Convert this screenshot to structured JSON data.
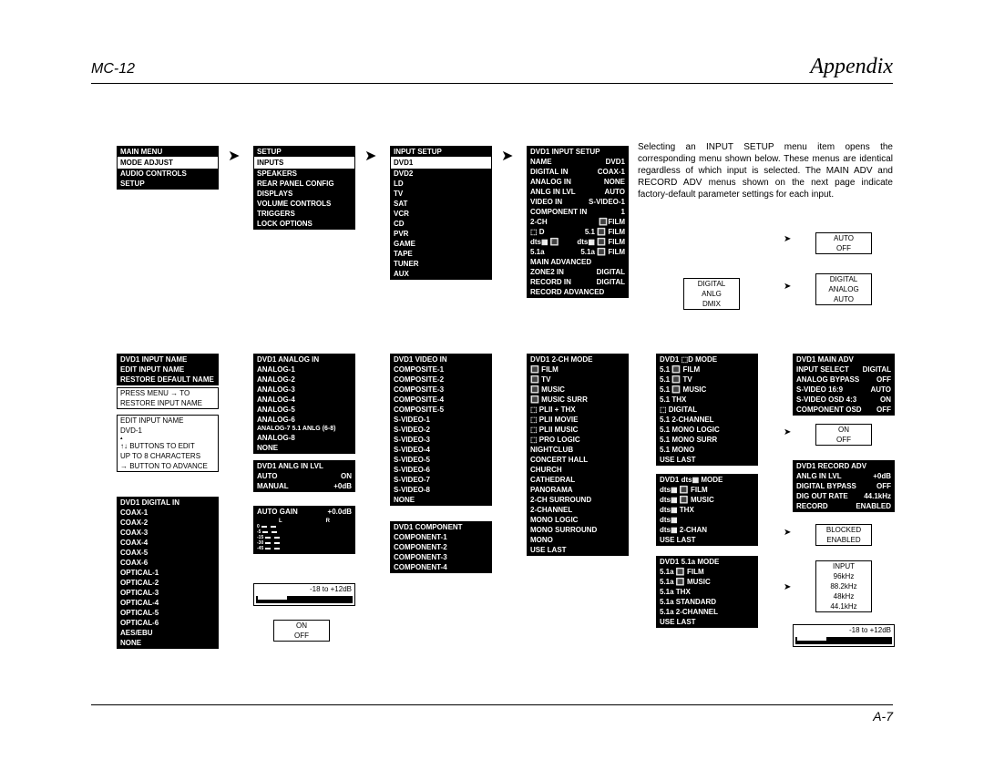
{
  "header": {
    "left": "MC-12",
    "right": "Appendix"
  },
  "footer": "A-7",
  "bodyText": "Selecting an INPUT SETUP menu item opens the corresponding menu shown below. These menus are identical regardless of which input is selected. The MAIN ADV and RECORD ADV menus shown on the next page indicate factory-default parameter settings for each input.",
  "mainMenu": {
    "title": "MAIN MENU",
    "sel": "MODE ADJUST",
    "items": [
      "AUDIO CONTROLS",
      "SETUP"
    ]
  },
  "setup": {
    "title": "SETUP",
    "sel": "INPUTS",
    "items": [
      "SPEAKERS",
      "REAR PANEL CONFIG",
      "DISPLAYS",
      "VOLUME CONTROLS",
      "TRIGGERS",
      "LOCK OPTIONS"
    ]
  },
  "inputSetup": {
    "title": "INPUT SETUP",
    "sel": "DVD1",
    "items": [
      "DVD2",
      "LD",
      "TV",
      "SAT",
      "VCR",
      "CD",
      "PVR",
      "GAME",
      "TAPE",
      "TUNER",
      "AUX"
    ]
  },
  "dvd1InputSetup": {
    "title": "DVD1 INPUT SETUP",
    "rows": [
      [
        "NAME",
        "DVD1"
      ],
      [
        "DIGITAL IN",
        "COAX-1"
      ],
      [
        "ANALOG IN",
        "NONE"
      ],
      [
        "ANLG IN LVL",
        "AUTO"
      ],
      [
        "VIDEO IN",
        "S-VIDEO-1"
      ],
      [
        "COMPONENT IN",
        "1"
      ],
      [
        "2-CH",
        "🔳FILM"
      ],
      [
        "⬚ D",
        "5.1 🔳 FILM"
      ],
      [
        "dts▦ 🔳",
        "dts▦ 🔳 FILM"
      ],
      [
        "5.1a",
        "5.1a 🔳 FILM"
      ],
      [
        "MAIN ADVANCED",
        ""
      ],
      [
        "ZONE2 IN",
        "DIGITAL"
      ],
      [
        "RECORD IN",
        "DIGITAL"
      ],
      [
        "RECORD ADVANCED",
        ""
      ]
    ]
  },
  "inputName": {
    "title": "DVD1 INPUT NAME",
    "items": [
      "EDIT INPUT NAME",
      "RESTORE DEFAULT NAME"
    ]
  },
  "inputNameNote1": [
    "PRESS MENU → TO",
    "RESTORE INPUT NAME"
  ],
  "inputNameNote2": {
    "title": "EDIT INPUT NAME",
    "val": "DVD-1",
    "lines": [
      "↑↓ BUTTONS TO EDIT",
      "UP TO 8 CHARACTERS",
      "→ BUTTON TO ADVANCE"
    ]
  },
  "digitalIn": {
    "title": "DVD1 DIGITAL IN",
    "items": [
      "COAX-1",
      "COAX-2",
      "COAX-3",
      "COAX-4",
      "COAX-5",
      "COAX-6",
      "OPTICAL-1",
      "OPTICAL-2",
      "OPTICAL-3",
      "OPTICAL-4",
      "OPTICAL-5",
      "OPTICAL-6",
      "AES/EBU",
      "NONE"
    ]
  },
  "analogIn": {
    "title": "DVD1 ANALOG IN",
    "items": [
      "ANALOG-1",
      "ANALOG-2",
      "ANALOG-3",
      "ANALOG-4",
      "ANALOG-5",
      "ANALOG-6",
      "ANALOG-7  5.1 ANLG (6-8)",
      "ANALOG-8",
      "NONE"
    ]
  },
  "anlgInLvl": {
    "title": "DVD1 ANLG IN LVL",
    "rows": [
      [
        "AUTO",
        "ON"
      ],
      [
        "MANUAL",
        "+0dB"
      ]
    ]
  },
  "autoGain": {
    "title": "AUTO GAIN",
    "val": "+0.0dB",
    "ticks": [
      "0",
      "-5",
      "-15",
      "-30",
      "-45"
    ],
    "lr": [
      "L",
      "R"
    ],
    "range": "-18 to +12dB"
  },
  "onOff": [
    "ON",
    "OFF"
  ],
  "videoIn": {
    "title": "DVD1 VIDEO IN",
    "items": [
      "COMPOSITE-1",
      "COMPOSITE-2",
      "COMPOSITE-3",
      "COMPOSITE-4",
      "COMPOSITE-5",
      "S-VIDEO-1",
      "S-VIDEO-2",
      "S-VIDEO-3",
      "S-VIDEO-4",
      "S-VIDEO-5",
      "S-VIDEO-6",
      "S-VIDEO-7",
      "S-VIDEO-8",
      "NONE"
    ]
  },
  "component": {
    "title": "DVD1 COMPONENT",
    "items": [
      "COMPONENT-1",
      "COMPONENT-2",
      "COMPONENT-3",
      "COMPONENT-4"
    ]
  },
  "chMode": {
    "title": "DVD1 2-CH MODE",
    "items": [
      "🔳 FILM",
      "🔳 TV",
      "🔳 MUSIC",
      "🔳 MUSIC SURR",
      "⬚ PLII + THX",
      "⬚ PLII MOVIE",
      "⬚ PLII MUSIC",
      "⬚ PRO LOGIC",
      "NIGHTCLUB",
      "CONCERT HALL",
      "CHURCH",
      "CATHEDRAL",
      "PANORAMA",
      "2-CH SURROUND",
      "2-CHANNEL",
      "MONO LOGIC",
      "MONO SURROUND",
      "MONO",
      "USE LAST"
    ]
  },
  "ddMode": {
    "title": "DVD1 ⬚D MODE",
    "items": [
      "5.1 🔳 FILM",
      "5.1 🔳 TV",
      "5.1 🔳 MUSIC",
      "5.1 THX",
      "⬚ DIGITAL",
      "5.1 2-CHANNEL",
      "5.1 MONO LOGIC",
      "5.1 MONO SURR",
      "5.1 MONO",
      "USE LAST"
    ]
  },
  "dtsMode": {
    "title": "DVD1 dts▦ MODE",
    "items": [
      "dts▦ 🔳 FILM",
      "dts▦ 🔳 MUSIC",
      "dts▦ THX",
      "dts▦",
      "dts▦ 2-CHAN",
      "USE LAST"
    ]
  },
  "51aMode": {
    "title": "DVD1 5.1a MODE",
    "items": [
      "5.1a 🔳 FILM",
      "5.1a 🔳 MUSIC",
      "5.1a THX",
      "5.1a STANDARD",
      "5.1a 2-CHANNEL",
      "USE LAST"
    ]
  },
  "zoneOpts": [
    "DIGITAL",
    "ANLG",
    "DMIX"
  ],
  "mainAdv": {
    "title": "DVD1 MAIN ADV",
    "rows": [
      [
        "INPUT SELECT",
        "DIGITAL"
      ],
      [
        "ANALOG BYPASS",
        "OFF"
      ],
      [
        "S-VIDEO 16:9",
        "AUTO"
      ],
      [
        "S-VIDEO OSD 4:3",
        "ON"
      ],
      [
        "COMPONENT OSD",
        "OFF"
      ]
    ]
  },
  "recordAdv": {
    "title": "DVD1 RECORD ADV",
    "rows": [
      [
        "ANLG IN LVL",
        "+0dB"
      ],
      [
        "DIGITAL BYPASS",
        "OFF"
      ],
      [
        "DIG OUT RATE",
        "44.1kHz"
      ],
      [
        "RECORD",
        "ENABLED"
      ]
    ]
  },
  "autoOff": [
    "AUTO",
    "OFF"
  ],
  "digAnaAuto": [
    "DIGITAL",
    "ANALOG",
    "AUTO"
  ],
  "blockEnable": [
    "BLOCKED",
    "ENABLED"
  ],
  "rates": [
    "INPUT",
    "96kHz",
    "88.2kHz",
    "48kHz",
    "44.1kHz"
  ],
  "range2": "-18 to +12dB"
}
